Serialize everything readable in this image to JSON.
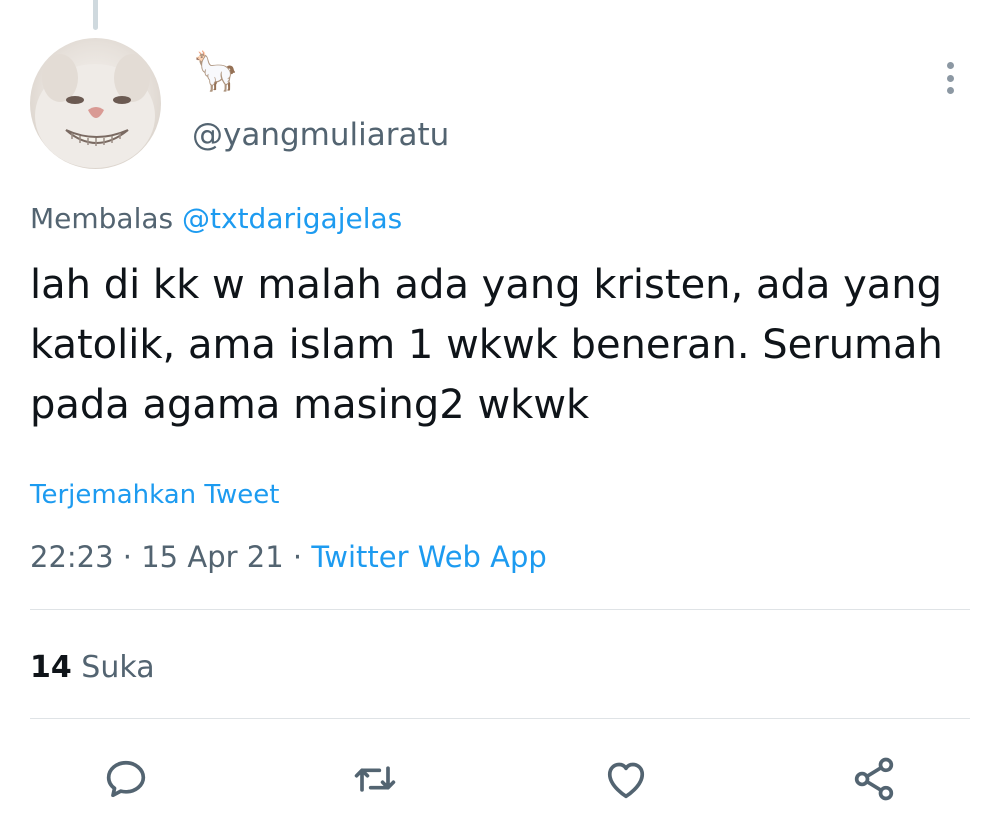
{
  "author": {
    "display_name": "🦙",
    "handle": "@yangmuliaratu"
  },
  "reply": {
    "prefix": "Membalas",
    "mention": "@txtdarigajelas"
  },
  "tweet": {
    "text": "lah di kk w malah ada yang kristen, ada yang katolik, ama islam 1 wkwk beneran. Serumah pada agama masing2 wkwk",
    "translate_label": "Terjemahkan Tweet",
    "time": "22:23",
    "separator": "·",
    "date": "15 Apr 21",
    "source": "Twitter Web App"
  },
  "stats": {
    "likes_count": "14",
    "likes_label": "Suka"
  },
  "actions": {
    "icons": [
      "reply-icon",
      "retweet-icon",
      "like-icon",
      "share-icon"
    ]
  },
  "colors": {
    "accent": "#1d9bf0",
    "secondary_text": "#536471",
    "icon": "#536471"
  }
}
